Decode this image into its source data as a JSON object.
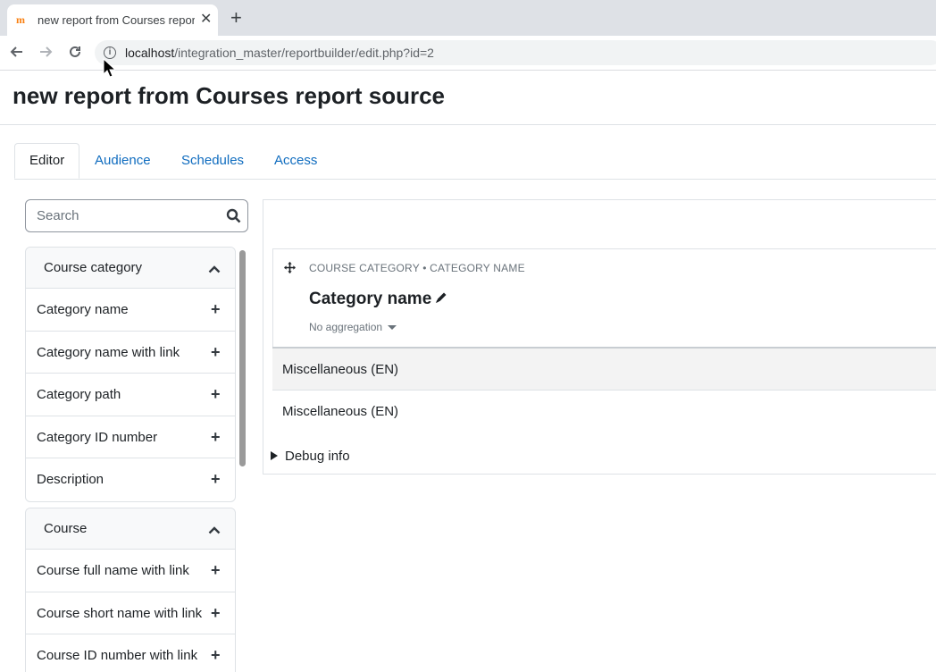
{
  "browser": {
    "tab_title": "new report from Courses report source",
    "favicon": "m",
    "url_host": "localhost",
    "url_path": "/integration_master/reportbuilder/edit.php?id=2"
  },
  "page": {
    "title": "new report from Courses report source",
    "tabs": [
      {
        "label": "Editor",
        "active": true
      },
      {
        "label": "Audience",
        "active": false
      },
      {
        "label": "Schedules",
        "active": false
      },
      {
        "label": "Access",
        "active": false
      }
    ]
  },
  "sidebar": {
    "search_placeholder": "Search",
    "groups": [
      {
        "title": "Course category",
        "items": [
          "Category name",
          "Category name with link",
          "Category path",
          "Category ID number",
          "Description"
        ]
      },
      {
        "title": "Course",
        "items": [
          "Course full name with link",
          "Course short name with link",
          "Course ID number with link"
        ]
      }
    ]
  },
  "editor": {
    "column_source": "COURSE CATEGORY • CATEGORY NAME",
    "column_name": "Category name",
    "aggregation": "No aggregation",
    "rows": [
      "Miscellaneous (EN)",
      "Miscellaneous (EN)"
    ],
    "debug_label": "Debug info"
  }
}
